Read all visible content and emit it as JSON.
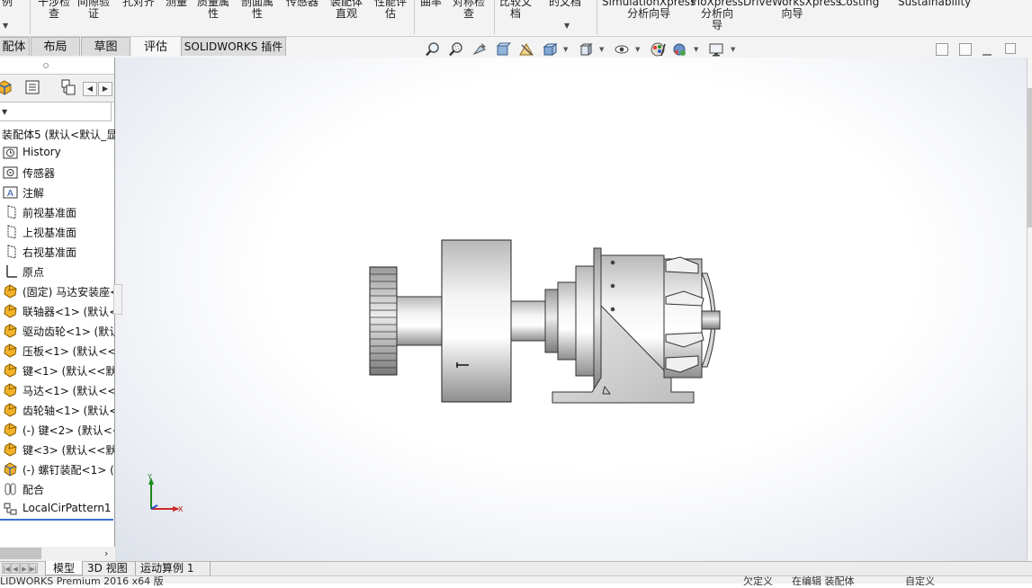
{
  "ribbon": {
    "items": [
      "例",
      "干涉检\n查",
      "间隙验\n证",
      "孔对齐",
      "测量",
      "质量属\n性",
      "剖面属\n性",
      "传感器",
      "装配体\n直观",
      "性能评\n估",
      "曲率",
      "对称检\n查",
      "比较文\n档",
      "的文档",
      "SimulationXpress\n分析向导",
      "FloXpress\n分析向\n导",
      "DriveWorksXpress\n向导",
      "Costing",
      "Sustainability"
    ]
  },
  "command_tabs": [
    "配体",
    "布局",
    "草图",
    "评估",
    "SOLIDWORKS 插件"
  ],
  "active_command_tab": "评估",
  "heads_up_icons": [
    "zoom-to-fit-icon",
    "zoom-to-area-icon",
    "previous-view-icon",
    "section-view-icon",
    "dynamic-annotation-icon",
    "view-orientation-icon",
    "display-style-icon",
    "hide-show-items-icon",
    "edit-appearance-icon",
    "apply-scene-icon",
    "view-settings-icon"
  ],
  "panel_tabs": [
    "featuremanager-tab-icon",
    "propertymanager-tab-icon",
    "configurationmanager-tab-icon"
  ],
  "tree": {
    "root": "装配体5 (默认<默认_显",
    "items": [
      {
        "label": "History",
        "icon": "history-icon"
      },
      {
        "label": "传感器",
        "icon": "sensor-icon"
      },
      {
        "label": "注解",
        "icon": "annotation-icon"
      },
      {
        "label": "前视基准面",
        "icon": "plane-icon"
      },
      {
        "label": "上视基准面",
        "icon": "plane-icon"
      },
      {
        "label": "右视基准面",
        "icon": "plane-icon"
      },
      {
        "label": "原点",
        "icon": "origin-icon"
      },
      {
        "label": "(固定) 马达安装座<",
        "icon": "part-icon"
      },
      {
        "label": "联轴器<1> (默认<<",
        "icon": "part-icon"
      },
      {
        "label": "驱动齿轮<1> (默认",
        "icon": "part-icon"
      },
      {
        "label": "压板<1> (默认<<默",
        "icon": "part-icon"
      },
      {
        "label": "键<1> (默认<<默认",
        "icon": "part-icon"
      },
      {
        "label": "马达<1> (默认<<默",
        "icon": "part-icon"
      },
      {
        "label": "齿轮轴<1> (默认<<",
        "icon": "part-icon"
      },
      {
        "label": "(-) 键<2> (默认<<",
        "icon": "part-icon"
      },
      {
        "label": "键<3> (默认<<默认",
        "icon": "part-icon"
      },
      {
        "label": "(-) 螺钉装配<1> (默",
        "icon": "subassembly-icon"
      },
      {
        "label": "配合",
        "icon": "mates-icon"
      },
      {
        "label": "LocalCirPattern1",
        "icon": "pattern-icon"
      }
    ]
  },
  "triad": {
    "y_label": "Y",
    "x_label": "X"
  },
  "bottom_tabs": [
    "模型",
    "3D 视图",
    "运动算例 1"
  ],
  "active_bottom_tab": "模型",
  "status": {
    "left": "LIDWORKS Premium 2016 x64 版",
    "right1": "欠定义",
    "right2": "在编辑 装配体",
    "right3": "自定义"
  },
  "colors": {
    "accent": "#3a6fd1",
    "part_icon": "#f2b32a",
    "tab_bg": "#dcdcdc"
  }
}
